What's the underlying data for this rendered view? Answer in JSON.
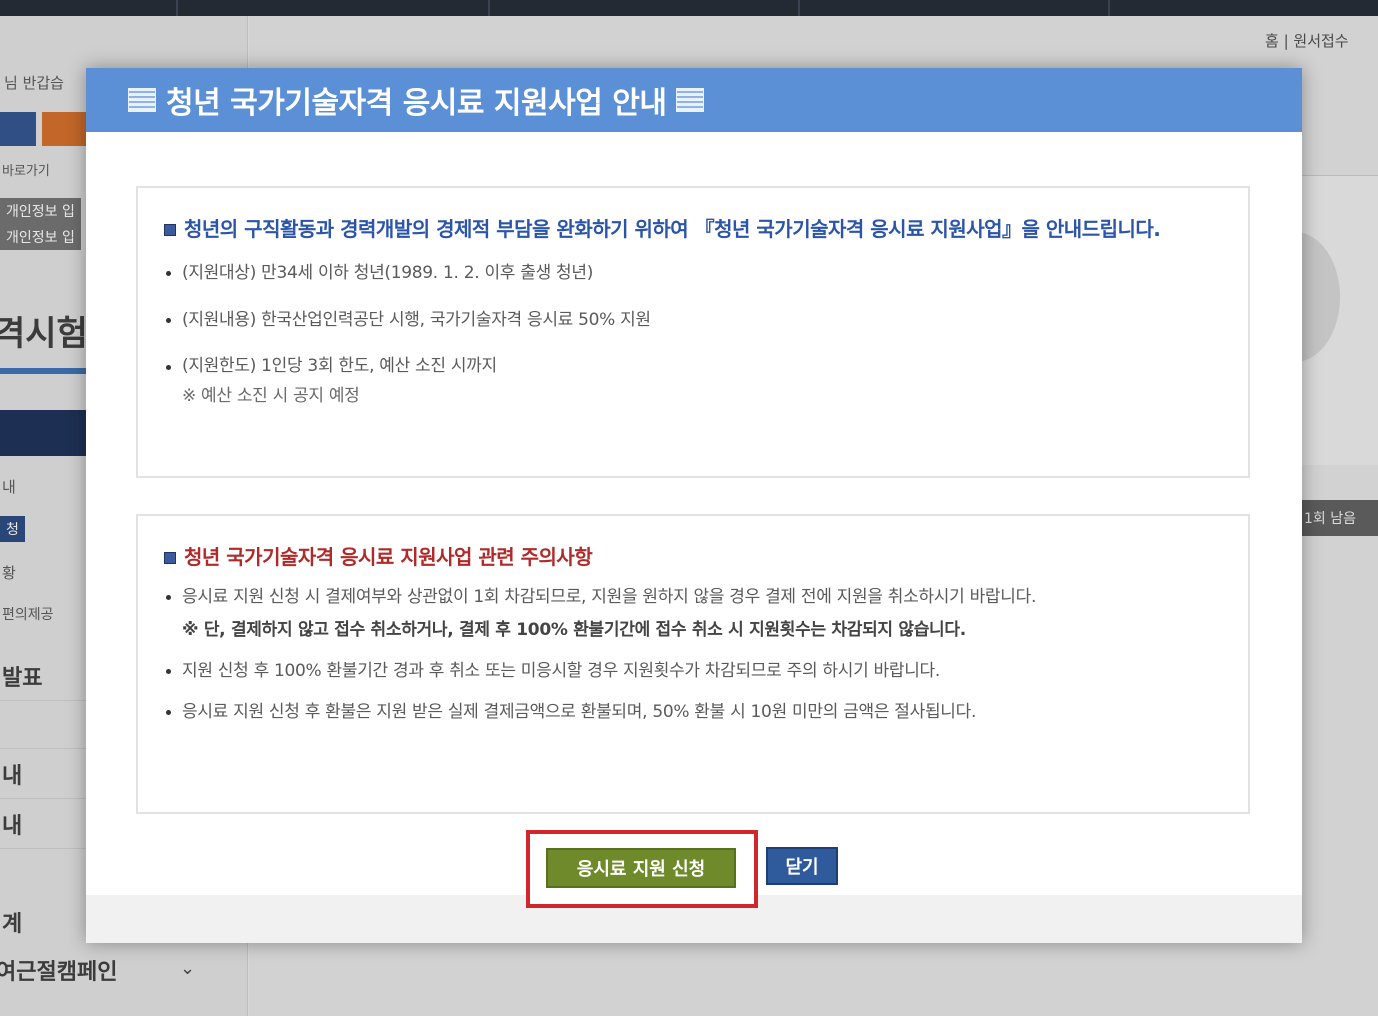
{
  "background": {
    "breadcrumb": "홈 | 원서접수",
    "left_labels": {
      "greeting": "님 반갑습",
      "back": "바로가기",
      "badge1": "개인정보 입",
      "badge2": "개인정보 입",
      "section_title": "격시험",
      "nav1": "내",
      "nav2": "청",
      "nav3": "황",
      "nav4": "편의제공",
      "announce": "발표",
      "item1": "내",
      "item2": "내",
      "item3": "계",
      "campaign": "여근절캠페인"
    },
    "right_bar": "1회 남음"
  },
  "modal": {
    "title": "청년 국가기술자격 응시료 지원사업 안내",
    "info": {
      "title": "청년의 구직활동과 경력개발의 경제적 부담을 완화하기 위하여 『청년 국가기술자격 응시료 지원사업』을 안내드립니다.",
      "items": [
        {
          "text": "(지원대상) 만34세 이하 청년(1989. 1. 2. 이후 출생 청년)"
        },
        {
          "text": "(지원내용) 한국산업인력공단 시행, 국가기술자격 응시료 50% 지원"
        },
        {
          "text": "(지원한도) 1인당 3회 한도, 예산 소진 시까지",
          "note": "※ 예산 소진 시 공지 예정"
        }
      ]
    },
    "caution": {
      "title": "청년 국가기술자격 응시료 지원사업 관련 주의사항",
      "items": [
        {
          "text": "응시료 지원 신청 시 결제여부와 상관없이 1회 차감되므로, 지원을 원하지 않을 경우 결제 전에 지원을 취소하시기 바랍니다.",
          "note": "※ 단, 결제하지 않고 접수 취소하거나, 결제 후 100% 환불기간에 접수 취소 시 지원횟수는 차감되지 않습니다."
        },
        {
          "text": "지원 신청 후 100% 환불기간 경과 후 취소 또는 미응시할 경우 지원횟수가 차감되므로 주의 하시기 바랍니다."
        },
        {
          "text": "응시료 지원 신청 후 환불은 지원 받은 실제 결제금액으로 환불되며, 50% 환불 시 10원 미만의 금액은 절사됩니다."
        }
      ]
    },
    "buttons": {
      "apply": "응시료 지원 신청",
      "close": "닫기"
    }
  },
  "colors": {
    "header": "#5b8fd6",
    "info_title": "#2b55a8",
    "caution_title": "#b02a2a",
    "apply_button": "#6f8a2a",
    "close_button": "#2f5a9c",
    "highlight": "#d0262e"
  }
}
